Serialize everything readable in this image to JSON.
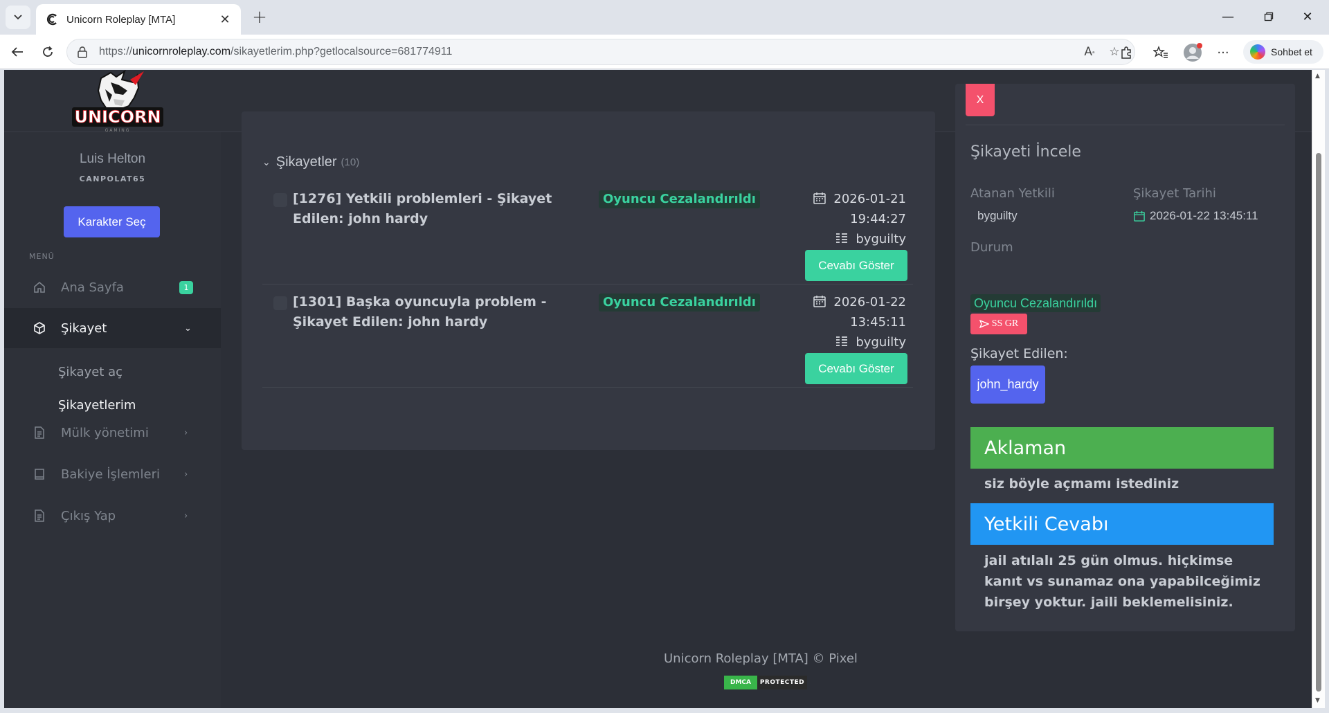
{
  "browser": {
    "tab_title": "Unicorn Roleplay [MTA]",
    "url_scheme": "https://",
    "url_host": "unicornroleplay.com",
    "url_path": "/sikayetlerim.php?getlocalsource=681774911",
    "copilot_label": "Sohbet et"
  },
  "sidebar": {
    "user_name": "Luis Helton",
    "user_code": "CANPOLAT65",
    "select_character": "Karakter Seç",
    "menu_label": "MENÜ",
    "items": [
      {
        "label": "Ana Sayfa",
        "badge": "1",
        "icon": "home-icon"
      },
      {
        "label": "Şikayet",
        "icon": "box-icon"
      },
      {
        "label": "Mülk yönetimi",
        "icon": "document-icon"
      },
      {
        "label": "Bakiye İşlemleri",
        "icon": "book-icon"
      },
      {
        "label": "Çıkış Yap",
        "icon": "document-icon"
      }
    ],
    "sub_items": [
      {
        "label": "Şikayet aç"
      },
      {
        "label": "Şikayetlerim"
      }
    ]
  },
  "complaints": {
    "section_title": "Şikayetler",
    "count": "(10)",
    "rows": [
      {
        "title": "[1276] Yetkili problemleri - Şikayet Edilen: john hardy",
        "status": "Oyuncu Cezalandırıldı",
        "date": "2026-01-21",
        "time": "19:44:27",
        "staff": "byguilty",
        "button": "Cevabı Göster"
      },
      {
        "title": "[1301] Başka oyuncuyla problem - Şikayet Edilen: john hardy",
        "status": "Oyuncu Cezalandırıldı",
        "date": "2026-01-22",
        "time": "13:45:11",
        "staff": "byguilty",
        "button": "Cevabı Göster"
      }
    ]
  },
  "detail": {
    "close": "X",
    "title": "Şikayeti İncele",
    "assigned_label": "Atanan Yetkili",
    "assigned_value": "byguilty",
    "date_label": "Şikayet Tarihi",
    "date_value": "2026-01-22 13:45:11",
    "status_label": "Durum",
    "status_value": "Oyuncu Cezalandırıldı",
    "ss_button": "SS GR",
    "reported_label": "Şikayet Edilen:",
    "reported_user": "john_hardy",
    "description_head": "Aklaman",
    "description_text": "siz böyle açmamı istediniz",
    "answer_head": "Yetkili Cevabı",
    "answer_text": "jail atılalı 25 gün olmus. hiçkimse kanıt vs sunamaz ona yapabilceğimiz birşey yoktur. jaili beklemelisiniz.",
    "colors": {
      "description": "#4caf50",
      "answer": "#2196f3"
    }
  },
  "footer": {
    "text": "Unicorn Roleplay [MTA] © Pixel",
    "dmca_left": "DMCA",
    "dmca_right": "PROTECTED"
  },
  "colors": {
    "accent": "#5464ee",
    "success": "#3ad29f",
    "danger": "#f4516c"
  }
}
